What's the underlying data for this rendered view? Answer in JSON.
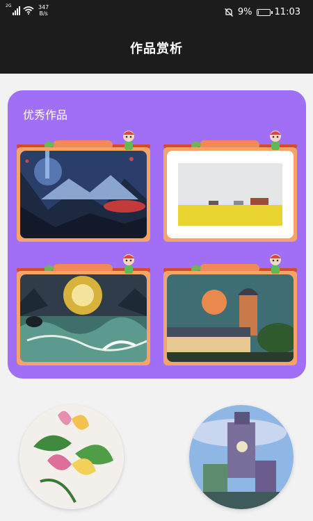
{
  "status_bar": {
    "network_type": "2G",
    "net_speed_value": "347",
    "net_speed_unit": "B/s",
    "battery_percent": "9%",
    "battery_level": 0.09,
    "time": "11:03"
  },
  "header": {
    "title": "作品赏析"
  },
  "featured": {
    "title": "优秀作品"
  },
  "colors": {
    "featured_bg": "#a06ff5",
    "frame_board": "#f6a368",
    "frame_rod": "#d64a2a",
    "frame_ribbon": "#f28a58"
  },
  "gallery": [
    {
      "subject": "night mountain landscape"
    },
    {
      "subject": "farmland landscape"
    },
    {
      "subject": "stormy sea with birds"
    },
    {
      "subject": "tower at sunset"
    }
  ],
  "more_artworks": [
    {
      "subject": "magnolia flower painting"
    },
    {
      "subject": "fantasy castle painting"
    }
  ]
}
